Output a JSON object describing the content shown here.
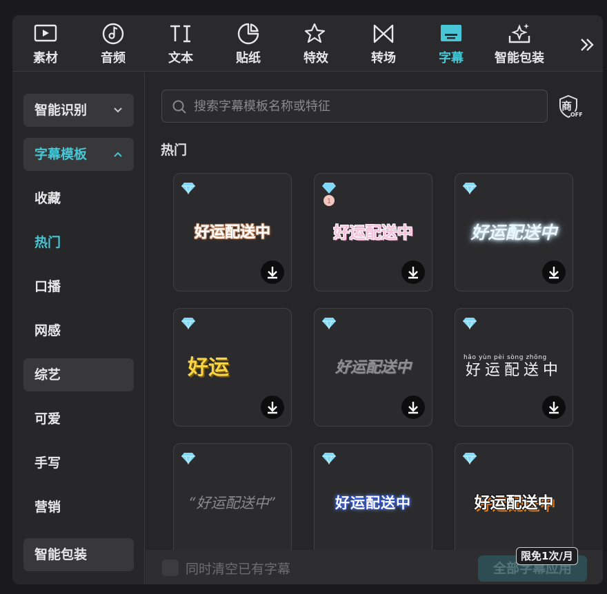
{
  "tabs": [
    {
      "label": "素材",
      "icon": "media-icon"
    },
    {
      "label": "音频",
      "icon": "music-icon"
    },
    {
      "label": "文本",
      "icon": "text-icon"
    },
    {
      "label": "贴纸",
      "icon": "sticker-icon"
    },
    {
      "label": "特效",
      "icon": "effects-icon"
    },
    {
      "label": "转场",
      "icon": "transition-icon"
    },
    {
      "label": "字幕",
      "icon": "subtitle-icon",
      "active": true
    },
    {
      "label": "智能包装",
      "icon": "smart-pack-icon"
    }
  ],
  "sidebar": {
    "items": [
      {
        "label": "智能识别",
        "chevron": "⌄"
      },
      {
        "label": "字幕模板",
        "chevron": "⌃"
      },
      {
        "label": "收藏"
      },
      {
        "label": "热门"
      },
      {
        "label": "口播"
      },
      {
        "label": "网感"
      },
      {
        "label": "综艺"
      },
      {
        "label": "可爱"
      },
      {
        "label": "手写"
      },
      {
        "label": "营销"
      },
      {
        "label": "智能包装"
      }
    ]
  },
  "search": {
    "placeholder": "搜索字幕模板名称或特征"
  },
  "shop_badge": {
    "text": "商",
    "sub": "OFF"
  },
  "section": {
    "title": "热门"
  },
  "cards": [
    {
      "text": "好运配送中",
      "badge": "diamond"
    },
    {
      "text": "好运配送中",
      "badge": "medal"
    },
    {
      "text": "好运配送中",
      "badge": "diamond"
    },
    {
      "text": "好运",
      "badge": "diamond"
    },
    {
      "text": "好运配送中",
      "badge": "diamond"
    },
    {
      "text": "好运配送中",
      "pinyin": "hǎo yùn pèi sòng zhōng",
      "badge": "diamond"
    },
    {
      "text": "“好运配送中”",
      "badge": "diamond"
    },
    {
      "text": "好运配送中",
      "badge": "diamond"
    },
    {
      "text": "好运配送中",
      "badge": "diamond"
    }
  ],
  "bottom": {
    "checkbox_label": "同时清空已有字幕",
    "apply_label": "全部字幕应用",
    "limit_badge": "限免1次/月"
  },
  "colors": {
    "accent": "#49c6d6",
    "diamond": "#7fd9f7"
  }
}
